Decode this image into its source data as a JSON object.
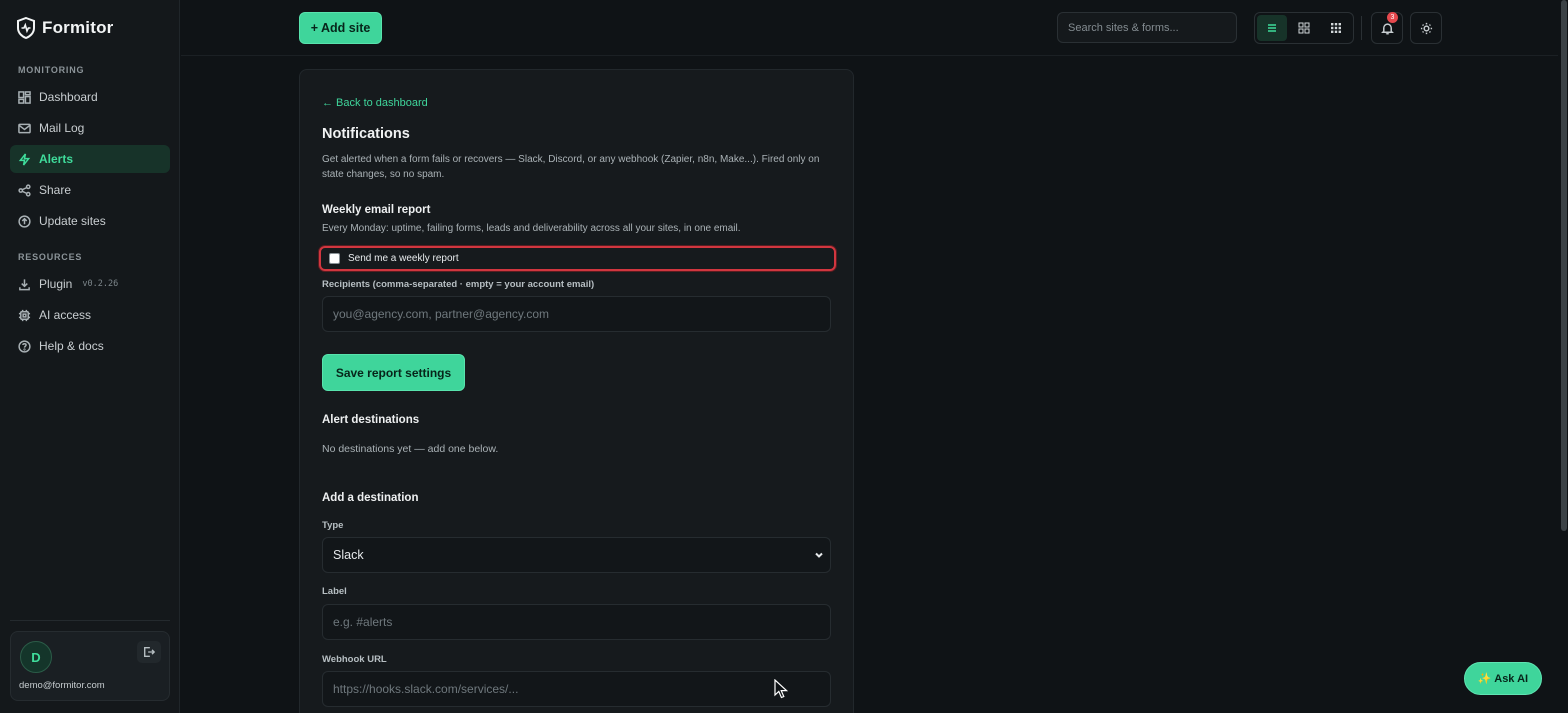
{
  "app": {
    "name": "Formitor"
  },
  "sidebar": {
    "monitoring_label": "MONITORING",
    "resources_label": "RESOURCES",
    "monitoring_items": [
      {
        "label": "Dashboard",
        "icon": "dashboard-icon"
      },
      {
        "label": "Mail Log",
        "icon": "mail-icon"
      },
      {
        "label": "Alerts",
        "icon": "bolt-icon",
        "active": true
      },
      {
        "label": "Share",
        "icon": "share-icon"
      },
      {
        "label": "Update sites",
        "icon": "update-icon"
      }
    ],
    "resource_items": [
      {
        "label": "Plugin",
        "icon": "download-icon",
        "version": "v0.2.26"
      },
      {
        "label": "AI access",
        "icon": "chip-icon"
      },
      {
        "label": "Help & docs",
        "icon": "help-icon"
      }
    ],
    "user": {
      "initial": "D",
      "email": "demo@formitor.com"
    }
  },
  "topbar": {
    "add_site_label": "+ Add site",
    "search_placeholder": "Search sites & forms...",
    "notification_count": "3"
  },
  "panel": {
    "back_link": "← Back to dashboard",
    "title": "Notifications",
    "description": "Get alerted when a form fails or recovers — Slack, Discord, or any webhook (Zapier, n8n, Make...). Fired only on state changes, so no spam.",
    "weekly": {
      "heading": "Weekly email report",
      "subtitle": "Every Monday: uptime, failing forms, leads and deliverability across all your sites, in one email.",
      "checkbox_label": "Send me a weekly report",
      "checked": false,
      "recipients_label": "Recipients (comma-separated · empty = your account email)",
      "recipients_placeholder": "you@agency.com, partner@agency.com",
      "save_label": "Save report settings"
    },
    "destinations": {
      "heading": "Alert destinations",
      "empty_text": "No destinations yet — add one below."
    },
    "add_destination": {
      "heading": "Add a destination",
      "type_label": "Type",
      "type_value": "Slack",
      "label_label": "Label",
      "label_placeholder": "e.g. #alerts",
      "webhook_label": "Webhook URL",
      "webhook_placeholder": "https://hooks.slack.com/services/..."
    }
  },
  "ask_ai": {
    "label": "✨ Ask AI"
  },
  "colors": {
    "accent": "#3fd59b",
    "danger": "#d1363f",
    "background": "#0f1316"
  }
}
